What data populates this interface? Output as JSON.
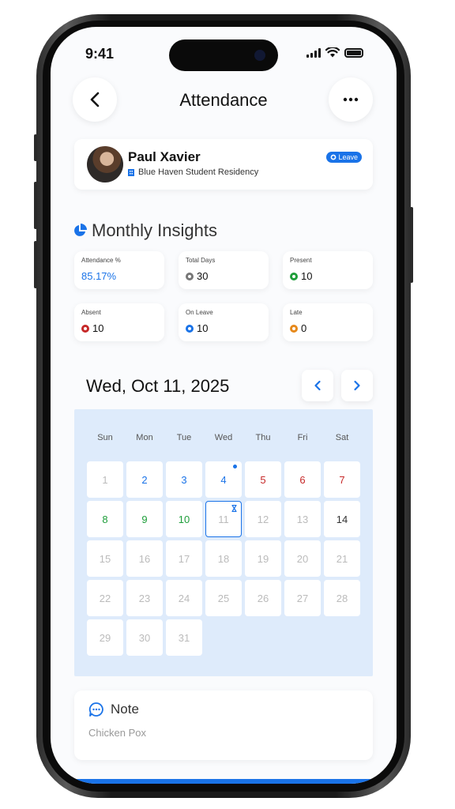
{
  "status": {
    "time": "9:41"
  },
  "header": {
    "title": "Attendance",
    "back_icon": "chevron-left-icon",
    "more_icon": "more-horizontal-icon"
  },
  "profile": {
    "name": "Paul Xavier",
    "residence": "Blue Haven Student Residency",
    "badge": "Leave"
  },
  "insights": {
    "title": "Monthly Insights",
    "stats": [
      {
        "label": "Attendance %",
        "value": "85.17%",
        "color": "#1a73e8",
        "dot": null
      },
      {
        "label": "Total Days",
        "value": "30",
        "dot": "#777777"
      },
      {
        "label": "Present",
        "value": "10",
        "dot": "#1e9e3a"
      },
      {
        "label": "Absent",
        "value": "10",
        "dot": "#c62828"
      },
      {
        "label": "On Leave",
        "value": "10",
        "dot": "#1a73e8"
      },
      {
        "label": "Late",
        "value": "0",
        "dot": "#e6891b"
      }
    ]
  },
  "calendar": {
    "date_title": "Wed, Oct 11, 2025",
    "weekdays": [
      "Sun",
      "Mon",
      "Tue",
      "Wed",
      "Thu",
      "Fri",
      "Sat"
    ],
    "days": [
      {
        "n": "1",
        "status": "past"
      },
      {
        "n": "2",
        "status": "leave"
      },
      {
        "n": "3",
        "status": "leave"
      },
      {
        "n": "4",
        "status": "leave",
        "marker": "dot"
      },
      {
        "n": "5",
        "status": "absent"
      },
      {
        "n": "6",
        "status": "absent"
      },
      {
        "n": "7",
        "status": "absent"
      },
      {
        "n": "8",
        "status": "present"
      },
      {
        "n": "9",
        "status": "present"
      },
      {
        "n": "10",
        "status": "present"
      },
      {
        "n": "11",
        "status": "selected",
        "marker": "hourglass"
      },
      {
        "n": "12",
        "status": "future"
      },
      {
        "n": "13",
        "status": "future"
      },
      {
        "n": "14",
        "status": "today"
      },
      {
        "n": "15",
        "status": "future"
      },
      {
        "n": "16",
        "status": "future"
      },
      {
        "n": "17",
        "status": "future"
      },
      {
        "n": "18",
        "status": "future"
      },
      {
        "n": "19",
        "status": "future"
      },
      {
        "n": "20",
        "status": "future"
      },
      {
        "n": "21",
        "status": "future"
      },
      {
        "n": "22",
        "status": "future"
      },
      {
        "n": "23",
        "status": "future"
      },
      {
        "n": "24",
        "status": "future"
      },
      {
        "n": "25",
        "status": "future"
      },
      {
        "n": "26",
        "status": "future"
      },
      {
        "n": "27",
        "status": "future"
      },
      {
        "n": "28",
        "status": "future"
      },
      {
        "n": "29",
        "status": "future"
      },
      {
        "n": "30",
        "status": "future"
      },
      {
        "n": "31",
        "status": "future"
      }
    ],
    "colors": {
      "leave": "#1a73e8",
      "absent": "#c62828",
      "present": "#1e9e3a",
      "today": "#333333",
      "future": "#bbbbbb",
      "past": "#bbbbbb",
      "selected": "#bbbbbb"
    }
  },
  "note": {
    "title": "Note",
    "body": "Chicken Pox"
  }
}
